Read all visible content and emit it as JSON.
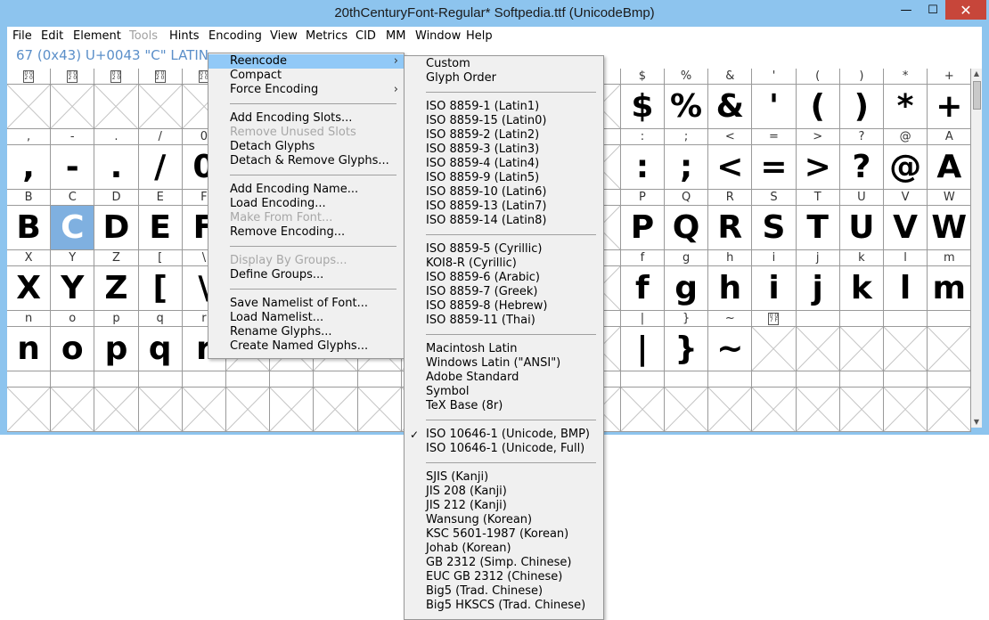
{
  "window": {
    "title": "20thCenturyFont-Regular*  Softpedia.ttf (UnicodeBmp)",
    "controls": {
      "minimize": "—",
      "maximize": "☐",
      "close": "✕"
    }
  },
  "menubar": [
    "File",
    "Edit",
    "Element",
    "Tools",
    "Hints",
    "Encoding",
    "View",
    "Metrics",
    "CID",
    "MM",
    "Window",
    "Help"
  ],
  "info_line": "67 (0x43) U+0043 \"C\" LATIN",
  "grid": {
    "rows": [
      {
        "labels": [
          "",
          "",
          "",
          "",
          "",
          "",
          "",
          "",
          "",
          "",
          "",
          "",
          "",
          "",
          "$",
          "%",
          "&",
          "'",
          "(",
          ")",
          "*",
          "+"
        ],
        "glyphs": [
          "",
          "",
          "",
          "",
          "",
          "",
          "",
          "",
          "",
          "",
          "",
          "",
          "",
          "",
          "$",
          "%",
          "&",
          "'",
          "(",
          ")",
          "*",
          "+"
        ]
      },
      {
        "labels": [
          ",",
          "-",
          ".",
          "/",
          "0",
          "",
          "",
          "",
          "",
          "",
          "",
          "",
          "",
          "",
          ":",
          ";",
          "<",
          "=",
          ">",
          "?",
          "@",
          "A"
        ],
        "glyphs": [
          ",",
          "-",
          ".",
          "/",
          "0",
          "",
          "",
          "",
          "",
          "",
          "",
          "",
          "",
          "",
          ":",
          ";",
          "<",
          "=",
          ">",
          "?",
          "@",
          "A"
        ]
      },
      {
        "labels": [
          "B",
          "C",
          "D",
          "E",
          "F",
          "",
          "",
          "",
          "",
          "",
          "",
          "",
          "",
          "",
          "P",
          "Q",
          "R",
          "S",
          "T",
          "U",
          "V",
          "W"
        ],
        "glyphs": [
          "B",
          "C",
          "D",
          "E",
          "F",
          "",
          "",
          "",
          "",
          "",
          "",
          "",
          "",
          "",
          "P",
          "Q",
          "R",
          "S",
          "T",
          "U",
          "V",
          "W"
        ]
      },
      {
        "labels": [
          "X",
          "Y",
          "Z",
          "[",
          "\\",
          "",
          "",
          "",
          "",
          "",
          "",
          "",
          "",
          "",
          "f",
          "g",
          "h",
          "i",
          "j",
          "k",
          "l",
          "m"
        ],
        "glyphs": [
          "X",
          "Y",
          "Z",
          "[",
          "\\",
          "",
          "",
          "",
          "",
          "",
          "",
          "",
          "",
          "",
          "f",
          "g",
          "h",
          "i",
          "j",
          "k",
          "l",
          "m"
        ]
      },
      {
        "labels": [
          "n",
          "o",
          "p",
          "q",
          "r",
          "",
          "",
          "",
          "",
          "",
          "",
          "",
          "",
          "",
          "|",
          "}",
          "~",
          "",
          "",
          "",
          "",
          ""
        ],
        "glyphs": [
          "n",
          "o",
          "p",
          "q",
          "r",
          "",
          "",
          "",
          "",
          "",
          "",
          "",
          "",
          "",
          "|",
          "}",
          "~",
          "",
          "",
          "",
          "",
          ""
        ]
      }
    ],
    "selected": "C"
  },
  "encoding_menu": {
    "items": [
      {
        "label": "Reencode",
        "submenu": true,
        "highlighted": true
      },
      {
        "label": "Compact"
      },
      {
        "label": "Force Encoding",
        "submenu": true
      },
      {
        "sep": true
      },
      {
        "label": "Add Encoding Slots..."
      },
      {
        "label": "Remove Unused Slots",
        "disabled": true
      },
      {
        "label": "Detach Glyphs"
      },
      {
        "label": "Detach & Remove Glyphs..."
      },
      {
        "sep": true
      },
      {
        "label": "Add Encoding Name..."
      },
      {
        "label": "Load Encoding..."
      },
      {
        "label": "Make From Font...",
        "disabled": true
      },
      {
        "label": "Remove Encoding..."
      },
      {
        "sep": true
      },
      {
        "label": "Display By Groups...",
        "disabled": true
      },
      {
        "label": "Define Groups..."
      },
      {
        "sep": true
      },
      {
        "label": "Save Namelist of Font..."
      },
      {
        "label": "Load Namelist..."
      },
      {
        "label": "Rename Glyphs..."
      },
      {
        "label": "Create Named Glyphs..."
      }
    ]
  },
  "reencode_menu": {
    "items": [
      {
        "label": "Custom"
      },
      {
        "label": "Glyph Order"
      },
      {
        "sep": true
      },
      {
        "label": "ISO 8859-1  (Latin1)"
      },
      {
        "label": "ISO 8859-15  (Latin0)"
      },
      {
        "label": "ISO 8859-2  (Latin2)"
      },
      {
        "label": "ISO 8859-3  (Latin3)"
      },
      {
        "label": "ISO 8859-4  (Latin4)"
      },
      {
        "label": "ISO 8859-9  (Latin5)"
      },
      {
        "label": "ISO 8859-10  (Latin6)"
      },
      {
        "label": "ISO 8859-13  (Latin7)"
      },
      {
        "label": "ISO 8859-14  (Latin8)"
      },
      {
        "sep": true
      },
      {
        "label": "ISO 8859-5 (Cyrillic)"
      },
      {
        "label": "KOI8-R (Cyrillic)"
      },
      {
        "label": "ISO 8859-6 (Arabic)"
      },
      {
        "label": "ISO 8859-7 (Greek)"
      },
      {
        "label": "ISO 8859-8 (Hebrew)"
      },
      {
        "label": "ISO 8859-11 (Thai)"
      },
      {
        "sep": true
      },
      {
        "label": "Macintosh Latin"
      },
      {
        "label": "Windows Latin (\"ANSI\")"
      },
      {
        "label": "Adobe Standard"
      },
      {
        "label": "Symbol"
      },
      {
        "label": "TeX Base (8r)"
      },
      {
        "sep": true
      },
      {
        "label": "ISO 10646-1 (Unicode, BMP)",
        "checked": true
      },
      {
        "label": "ISO 10646-1 (Unicode, Full)"
      },
      {
        "sep": true
      },
      {
        "label": "SJIS (Kanji)"
      },
      {
        "label": "JIS 208 (Kanji)"
      },
      {
        "label": "JIS 212 (Kanji)"
      },
      {
        "label": "Wansung (Korean)"
      },
      {
        "label": "KSC 5601-1987 (Korean)"
      },
      {
        "label": "Johab (Korean)"
      },
      {
        "label": "GB 2312 (Simp. Chinese)"
      },
      {
        "label": "EUC GB 2312 (Chinese)"
      },
      {
        "label": "Big5 (Trad. Chinese)"
      },
      {
        "label": "Big5 HKSCS (Trad. Chinese)"
      }
    ]
  }
}
